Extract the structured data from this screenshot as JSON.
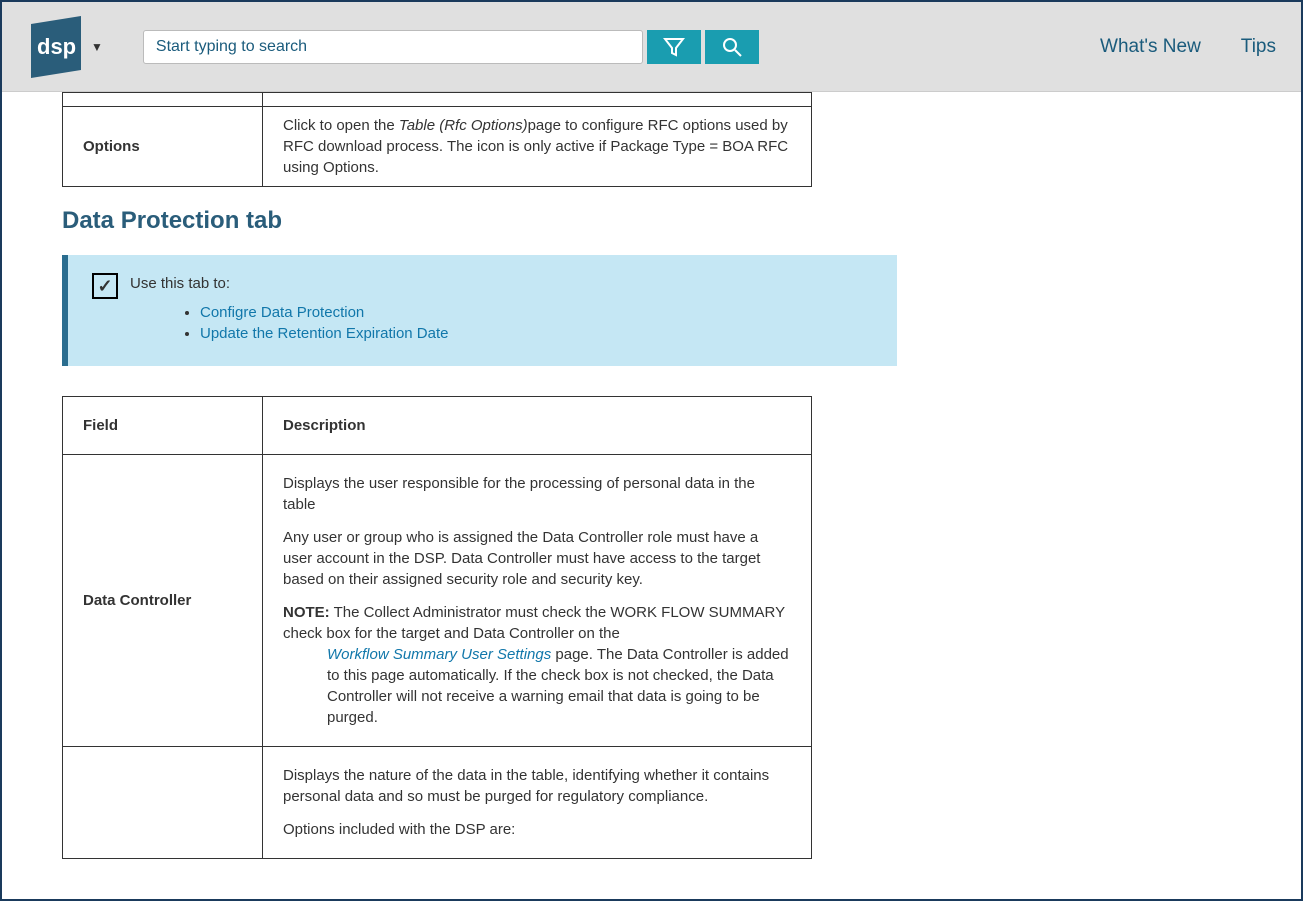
{
  "header": {
    "search_placeholder": "Start typing to search",
    "nav_whats_new": "What's New",
    "nav_tips": "Tips"
  },
  "top_table": {
    "row_label": "Options",
    "row_desc_prefix": "Click to open the ",
    "row_desc_italic": "Table (Rfc Options)",
    "row_desc_suffix": "page to configure RFC options used by RFC download process. The icon  is only active if Package Type = BOA RFC using Options."
  },
  "section_heading": "Data Protection tab",
  "callout": {
    "intro": "Use this tab to:",
    "links": {
      "configure": "Configre Data Protection",
      "update": "Update the Retention Expiration Date"
    }
  },
  "table2": {
    "headers": {
      "field": "Field",
      "description": "Description"
    },
    "rows": {
      "data_controller": {
        "label": "Data Controller",
        "p1": "Displays the user responsible for the processing of personal data in the table",
        "p2": "Any user or group who is assigned the Data Controller role must have a user account in the DSP. Data Controller must have access to the target based on their assigned security role and security key.",
        "note_label": "NOTE:",
        "note_pre": " The Collect Administrator must check the WORK FLOW SUMMARY check box for the target and Data Controller on the ",
        "note_link": "Workflow Summary User Settings",
        "note_post": " page. The Data Controller is added to this page automatically. If the check box is not checked, the Data Controller will not receive a warning email that data is going to be purged."
      },
      "row2": {
        "p1": "Displays the nature of the data in the table, identifying whether it contains personal data and so must be purged for regulatory compliance.",
        "p2": "Options included with the DSP are:"
      }
    }
  }
}
